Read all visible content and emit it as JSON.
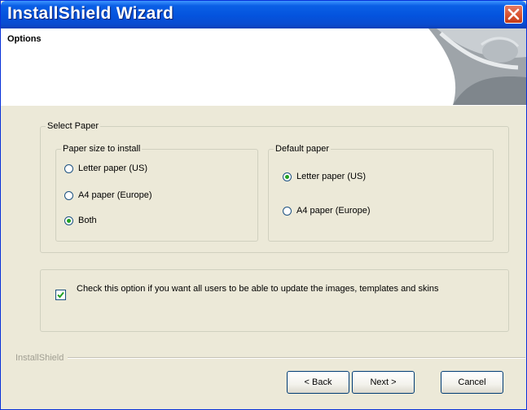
{
  "window": {
    "title": "InstallShield Wizard",
    "header_title": "Options"
  },
  "select_paper": {
    "legend": "Select Paper",
    "size_group": {
      "legend": "Paper size to install",
      "options": [
        {
          "label": "Letter paper (US)",
          "selected": false
        },
        {
          "label": "A4 paper (Europe)",
          "selected": false
        },
        {
          "label": "Both",
          "selected": true
        }
      ]
    },
    "default_group": {
      "legend": "Default paper",
      "options": [
        {
          "label": "Letter paper (US)",
          "selected": true
        },
        {
          "label": "A4 paper (Europe)",
          "selected": false
        }
      ]
    }
  },
  "all_users_option": {
    "checked": true,
    "label": "Check this option if you want all users to be able to update the images, templates and skins"
  },
  "footer": {
    "brand": "InstallShield",
    "back_label": "< Back",
    "next_label": "Next >",
    "cancel_label": "Cancel"
  },
  "colors": {
    "titlebar": "#0453dd",
    "dialog_bg": "#ece9d8",
    "close_button": "#d8512d",
    "radio_dot": "#21a121"
  },
  "icons": {
    "close": "close-x-icon",
    "header_art": "page-curl-icon",
    "check": "checkmark-icon"
  }
}
